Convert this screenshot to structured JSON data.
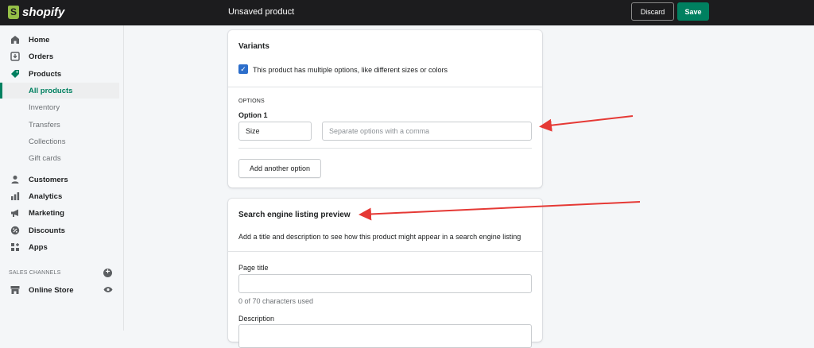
{
  "app": {
    "brand": "shopify"
  },
  "topbar": {
    "title": "Unsaved product",
    "discard_label": "Discard",
    "save_label": "Save"
  },
  "sidebar": {
    "items": [
      {
        "label": "Home",
        "icon": "home-icon"
      },
      {
        "label": "Orders",
        "icon": "orders-icon"
      },
      {
        "label": "Products",
        "icon": "tag-icon"
      },
      {
        "label": "All products"
      },
      {
        "label": "Inventory"
      },
      {
        "label": "Transfers"
      },
      {
        "label": "Collections"
      },
      {
        "label": "Gift cards"
      },
      {
        "label": "Customers",
        "icon": "person-icon"
      },
      {
        "label": "Analytics",
        "icon": "bar-chart-icon"
      },
      {
        "label": "Marketing",
        "icon": "megaphone-icon"
      },
      {
        "label": "Discounts",
        "icon": "discount-icon"
      },
      {
        "label": "Apps",
        "icon": "apps-icon"
      }
    ],
    "sales_channels_label": "SALES CHANNELS",
    "online_store_label": "Online Store"
  },
  "variants": {
    "title": "Variants",
    "checkbox_label": "This product has multiple options, like different sizes or colors",
    "checked": true,
    "options_caps": "OPTIONS",
    "option1_label": "Option 1",
    "option1_name": "Size",
    "option1_values_placeholder": "Separate options with a comma",
    "add_option_label": "Add another option"
  },
  "seo": {
    "title": "Search engine listing preview",
    "description": "Add a title and description to see how this product might appear in a search engine listing",
    "page_title_label": "Page title",
    "page_title_value": "",
    "char_count": "0 of 70 characters used",
    "description_label": "Description"
  },
  "colors": {
    "brand_green": "#008060",
    "topbar": "#1c1c1e",
    "checkbox_blue": "#2c6ecb",
    "annotation_red": "#e53935"
  }
}
